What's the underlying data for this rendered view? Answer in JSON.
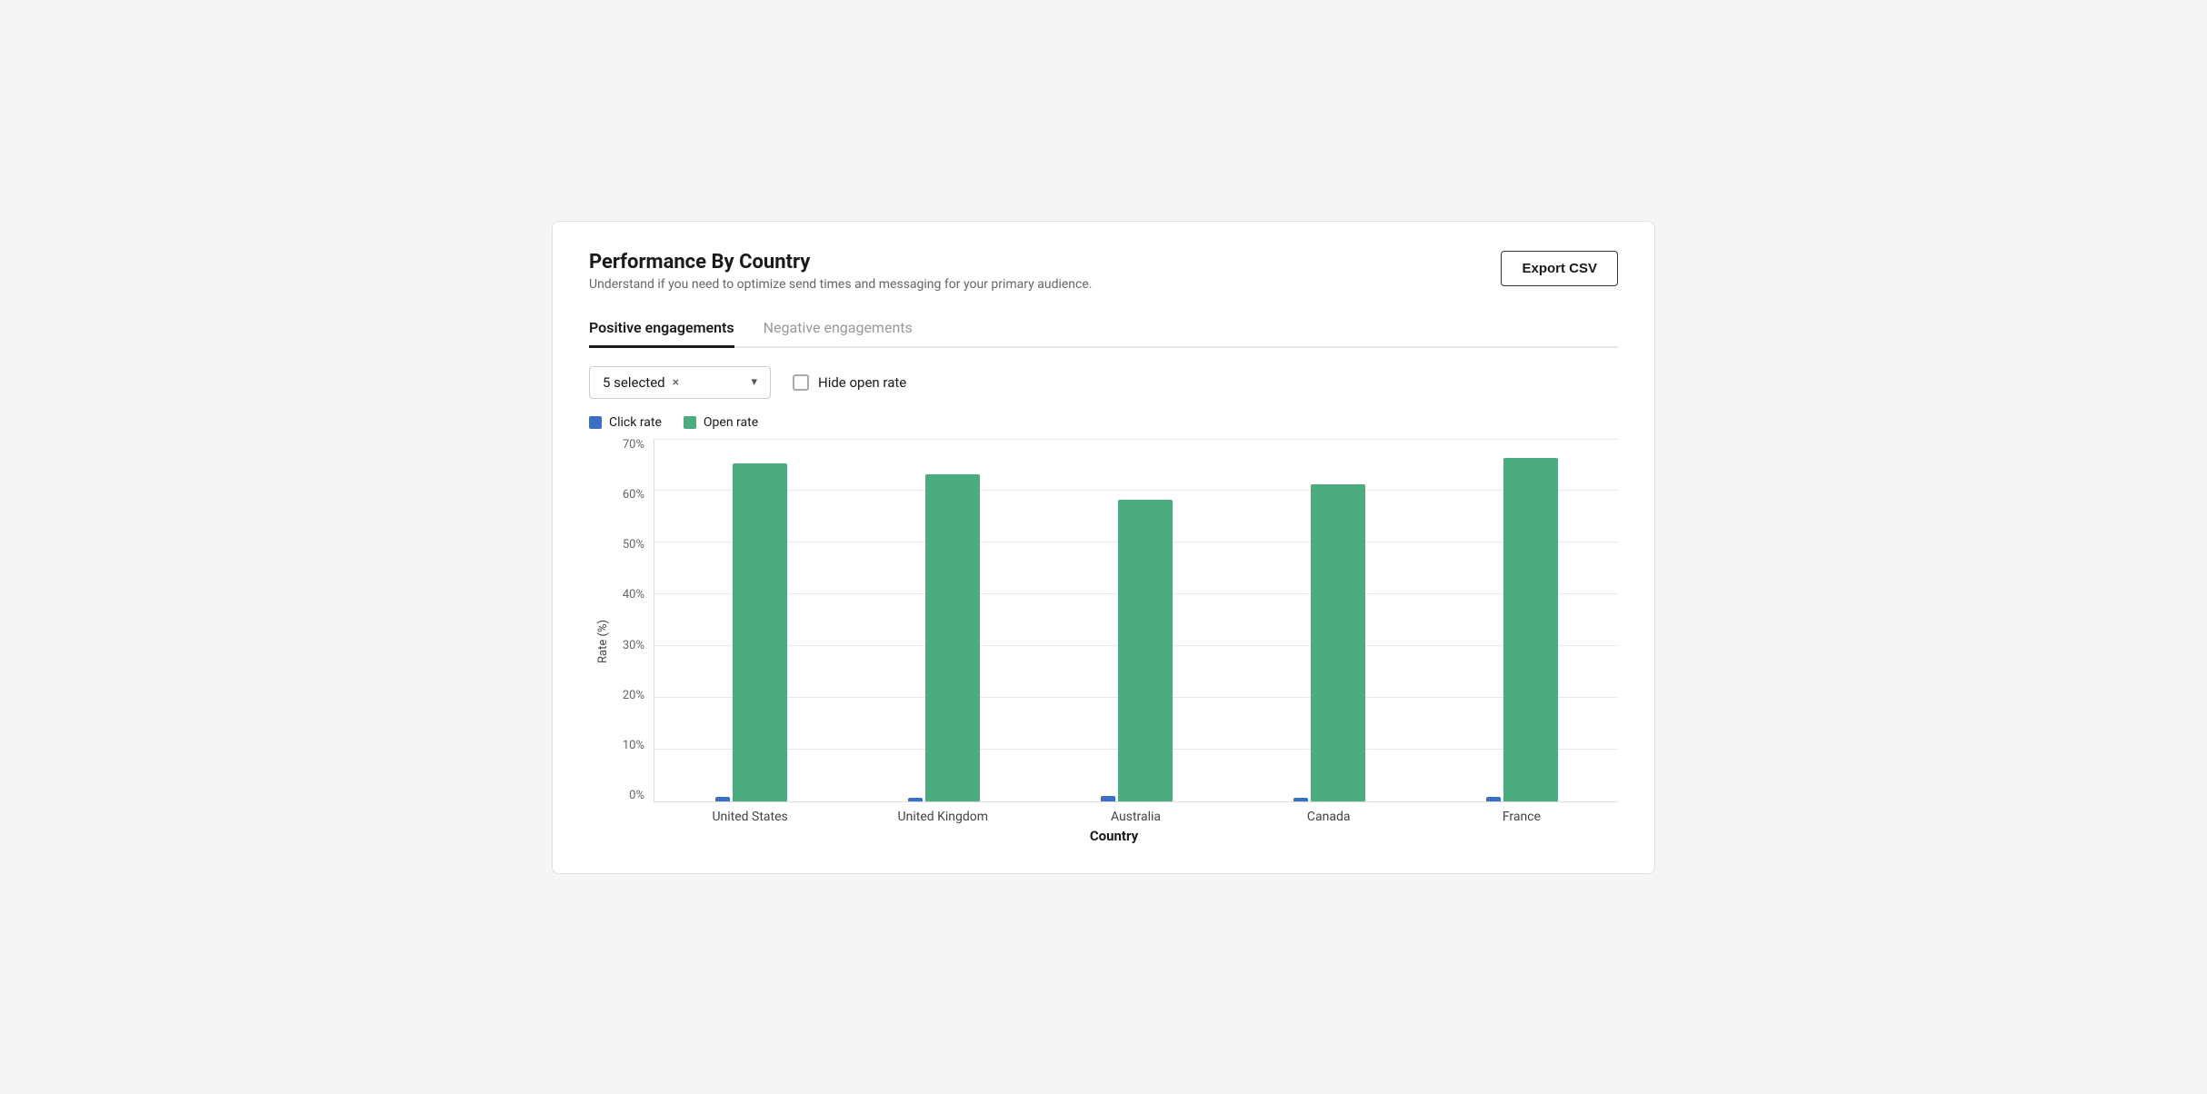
{
  "card": {
    "title": "Performance By Country",
    "subtitle": "Understand if you need to optimize send times and messaging for your primary audience.",
    "export_btn": "Export CSV"
  },
  "tabs": [
    {
      "label": "Positive engagements",
      "active": true
    },
    {
      "label": "Negative engagements",
      "active": false
    }
  ],
  "controls": {
    "dropdown": {
      "selected_label": "5 selected",
      "clear_icon": "×",
      "arrow_icon": "▾"
    },
    "hide_open_rate": {
      "label": "Hide open rate"
    }
  },
  "legend": {
    "click_rate_label": "Click rate",
    "open_rate_label": "Open rate"
  },
  "chart": {
    "y_axis_label": "Rate (%)",
    "x_axis_label": "Country",
    "y_ticks": [
      "0%",
      "10%",
      "20%",
      "30%",
      "40%",
      "50%",
      "60%",
      "70%"
    ],
    "max_value": 70,
    "countries": [
      {
        "name": "United States",
        "click_rate": 0.8,
        "open_rate": 65
      },
      {
        "name": "United Kingdom",
        "click_rate": 0.7,
        "open_rate": 63
      },
      {
        "name": "Australia",
        "click_rate": 0.9,
        "open_rate": 58
      },
      {
        "name": "Canada",
        "click_rate": 0.7,
        "open_rate": 61
      },
      {
        "name": "France",
        "click_rate": 0.8,
        "open_rate": 66
      }
    ],
    "colors": {
      "click": "#3a6fc4",
      "open": "#4cac80"
    }
  }
}
